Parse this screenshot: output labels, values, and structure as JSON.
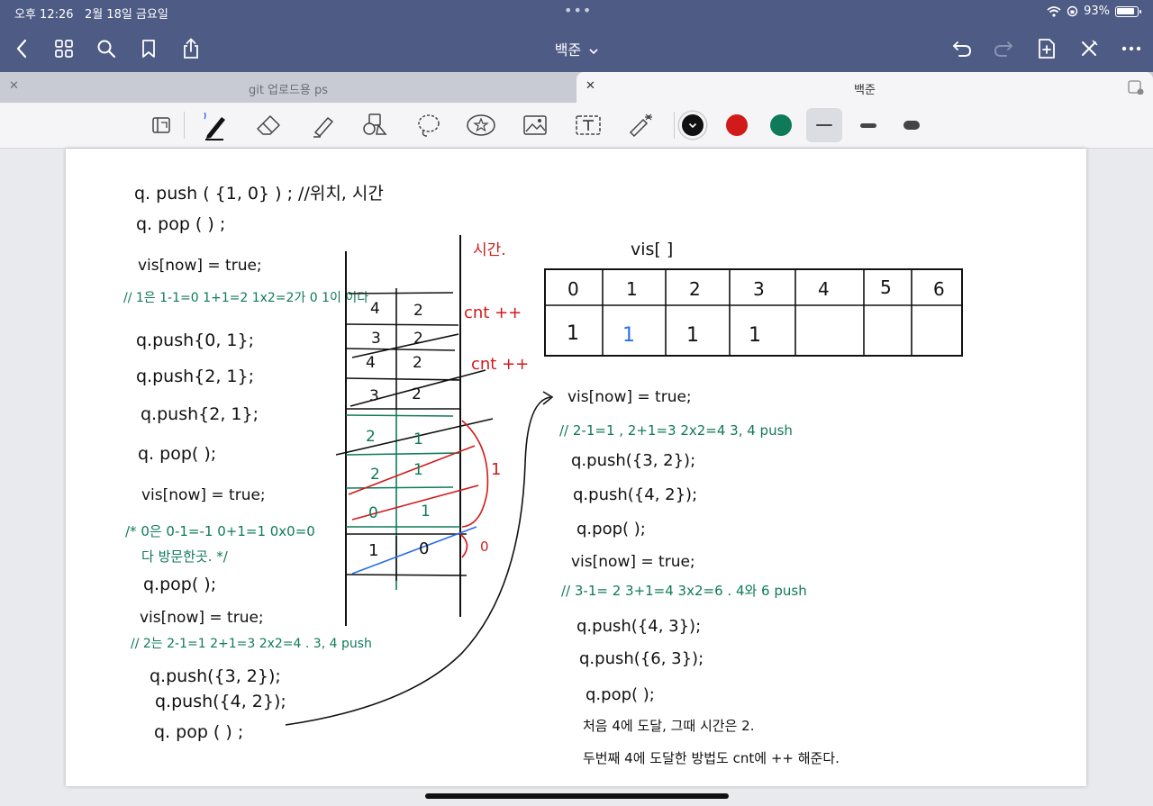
{
  "status_bar": {
    "time": "오후 12:26",
    "date": "2월 18일 금요일",
    "battery": "93%"
  },
  "nav": {
    "title": "백준",
    "title_chevron": "chevron-down-icon"
  },
  "tabs": [
    {
      "label": "git 업로드용 ps",
      "active": false
    },
    {
      "label": "백준",
      "active": true
    }
  ],
  "toolbar": {
    "colors": [
      "#111111",
      "#d11a1a",
      "#0f7a5a"
    ],
    "selected_stroke": "thin"
  },
  "notes": {
    "left": {
      "line1": "q. push ( {1, 0} ) ; //위치, 시간",
      "line2": "q. pop ( ) ;",
      "line3": "vis[now] = true;",
      "comment1": "// 1은 1-1=0 1+1=2 1x2=2가 0 1이 이다",
      "line4": "q.push{0, 1};",
      "line5": "q.push{2, 1};",
      "line6": "q.push{2, 1};",
      "line7": "q. pop( );",
      "line8": "vis[now] = true;",
      "comment2a": "/* 0은 0-1=-1 0+1=1 0x0=0",
      "comment2b": "다 방문한곳. */",
      "line9": "q.pop( );",
      "line10": "vis[now] = true;",
      "comment3": "// 2는 2-1=1 2+1=3 2x2=4 . 3, 4 push",
      "line11": "q.push({3, 2});",
      "line12": "q.push({4, 2});",
      "line13": "q. pop ( ) ;"
    },
    "queue": {
      "time_label": "시간.",
      "rows": [
        [
          "4",
          "2"
        ],
        [
          "3",
          "2"
        ],
        [
          "4",
          "2"
        ],
        [
          "3",
          "2"
        ],
        [
          "2",
          "1"
        ],
        [
          "2",
          "1"
        ],
        [
          "0",
          "1"
        ],
        [
          "1",
          "0"
        ]
      ],
      "cnt1": "cnt ++",
      "cnt2": "cnt ++",
      "bracket1": "1",
      "bracket0": "0"
    },
    "vis_table": {
      "title": "vis[ ]",
      "headers": [
        "0",
        "1",
        "2",
        "3",
        "4",
        "5",
        "6"
      ],
      "values": [
        "1",
        "1",
        "1",
        "1",
        "",
        "",
        ""
      ]
    },
    "right": {
      "line1": "vis[now] = true;",
      "comment1": "// 2-1=1 , 2+1=3 2x2=4   3, 4 push",
      "line2": "q.push({3, 2});",
      "line3": "q.push({4, 2});",
      "line4": "q.pop( );",
      "line5": "vis[now] = true;",
      "comment2": "// 3-1= 2 3+1=4 3x2=6 . 4와 6 push",
      "line6": "q.push({4, 3});",
      "line7": "q.push({6, 3});",
      "line8": "q.pop( );",
      "line9": "처음 4에 도달, 그때 시간은 2.",
      "line10": "두번째 4에 도달한 방법도 cnt에 ++ 해준다."
    }
  }
}
